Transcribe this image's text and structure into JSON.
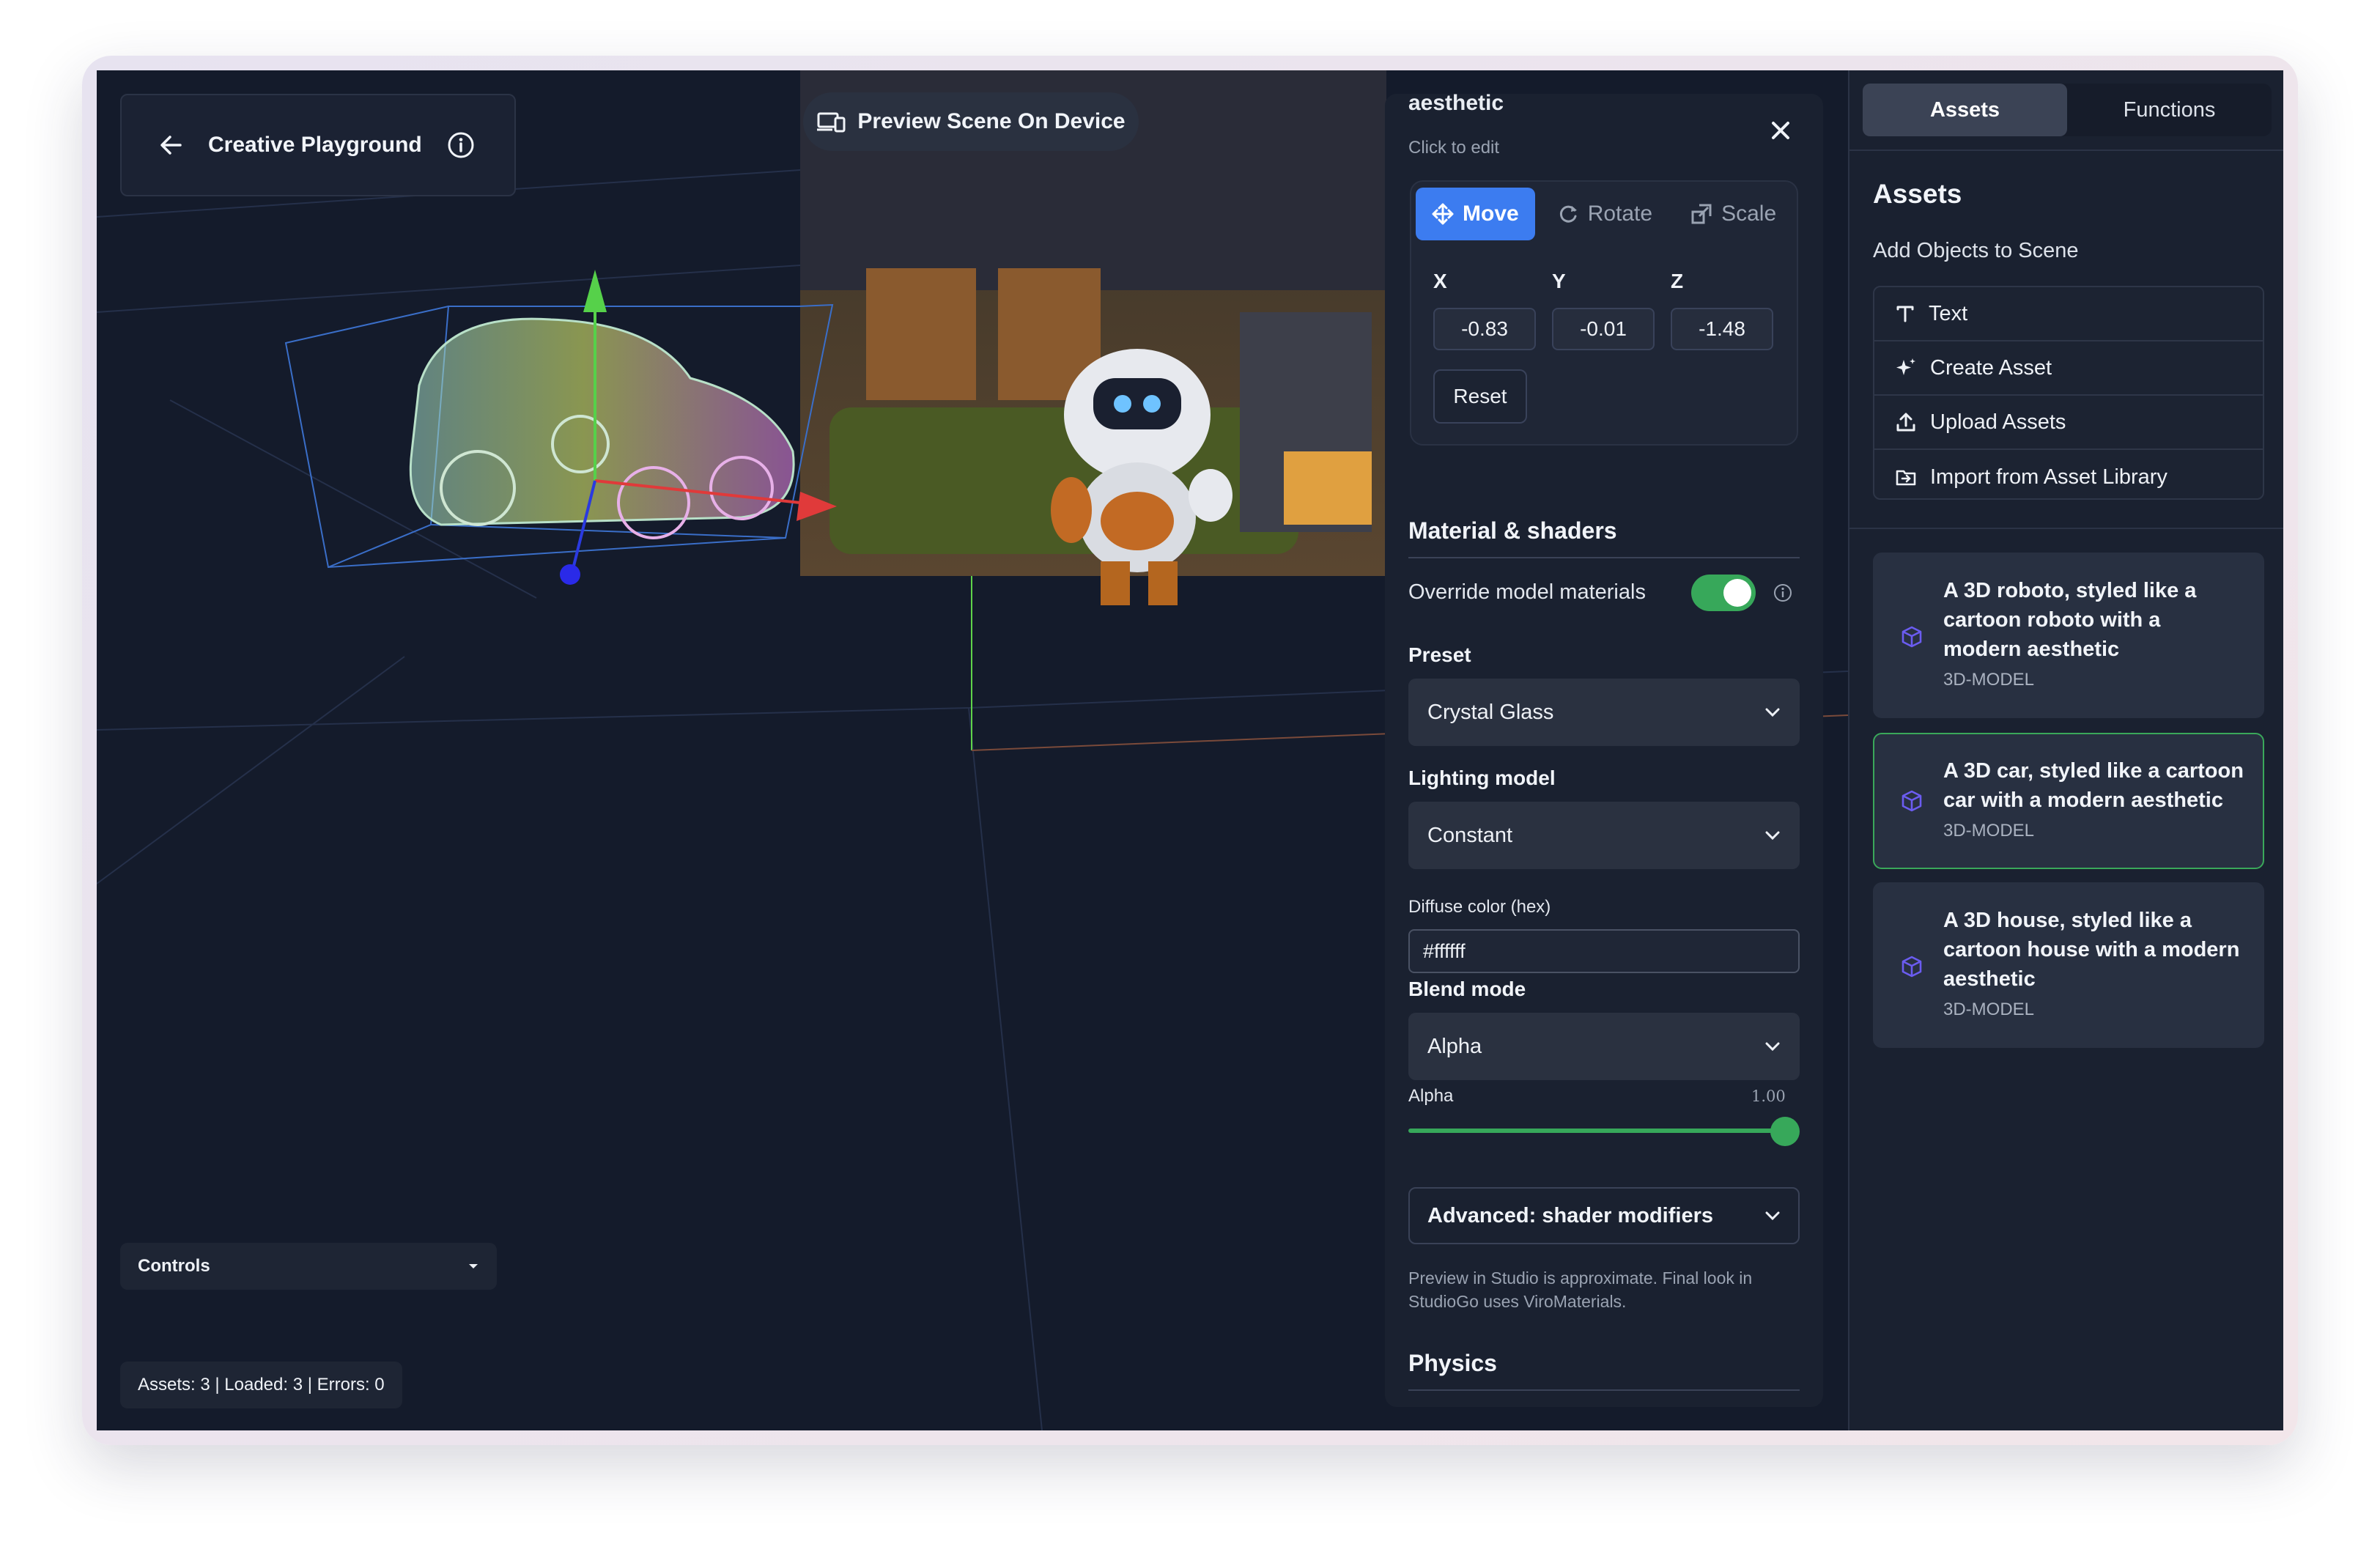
{
  "header": {
    "title": "Creative Playground",
    "preview_label": "Preview Scene On Device"
  },
  "viewport": {
    "controls_label": "Controls",
    "status": "Assets: 3 | Loaded: 3 | Errors: 0"
  },
  "properties": {
    "object_title": "aesthetic",
    "click_to_edit": "Click to edit",
    "tools": [
      {
        "label": "Move",
        "icon": "move-icon",
        "active": true
      },
      {
        "label": "Rotate",
        "icon": "rotate-icon",
        "active": false
      },
      {
        "label": "Scale",
        "icon": "scale-icon",
        "active": false
      }
    ],
    "axes": {
      "x_label": "X",
      "y_label": "Y",
      "z_label": "Z",
      "x_value": "-0.83",
      "y_value": "-0.01",
      "z_value": "-1.48"
    },
    "reset_label": "Reset",
    "material_heading": "Material & shaders",
    "override_label": "Override model materials",
    "override_enabled": true,
    "preset_label": "Preset",
    "preset_value": "Crystal Glass",
    "lighting_label": "Lighting model",
    "lighting_value": "Constant",
    "diffuse_label": "Diffuse color (hex)",
    "diffuse_value": "#ffffff",
    "blend_label": "Blend mode",
    "blend_value": "Alpha",
    "alpha_label": "Alpha",
    "alpha_value": "1.00",
    "alpha_fraction": 1.0,
    "advanced_label": "Advanced: shader modifiers",
    "note": "Preview in Studio is approximate. Final look in StudioGo uses ViroMaterials.",
    "physics_heading": "Physics",
    "accent_color": "#3c7cf0",
    "toggle_color": "#37a85a"
  },
  "sidebar": {
    "tabs": [
      {
        "label": "Assets",
        "active": true
      },
      {
        "label": "Functions",
        "active": false
      }
    ],
    "heading": "Assets",
    "subheading": "Add Objects to Scene",
    "add_items": [
      {
        "label": "Text",
        "icon": "text-icon"
      },
      {
        "label": "Create Asset",
        "icon": "sparkle-icon"
      },
      {
        "label": "Upload Assets",
        "icon": "upload-icon"
      },
      {
        "label": "Import from Asset Library",
        "icon": "folder-import-icon"
      }
    ],
    "assets": [
      {
        "name": "A 3D roboto, styled like a cartoon roboto with a modern aesthetic",
        "kind": "3D-MODEL",
        "selected": false
      },
      {
        "name": "A 3D car, styled like a cartoon car with a modern aesthetic",
        "kind": "3D-MODEL",
        "selected": true
      },
      {
        "name": "A 3D house, styled like a cartoon house with a modern aesthetic",
        "kind": "3D-MODEL",
        "selected": false
      }
    ]
  }
}
